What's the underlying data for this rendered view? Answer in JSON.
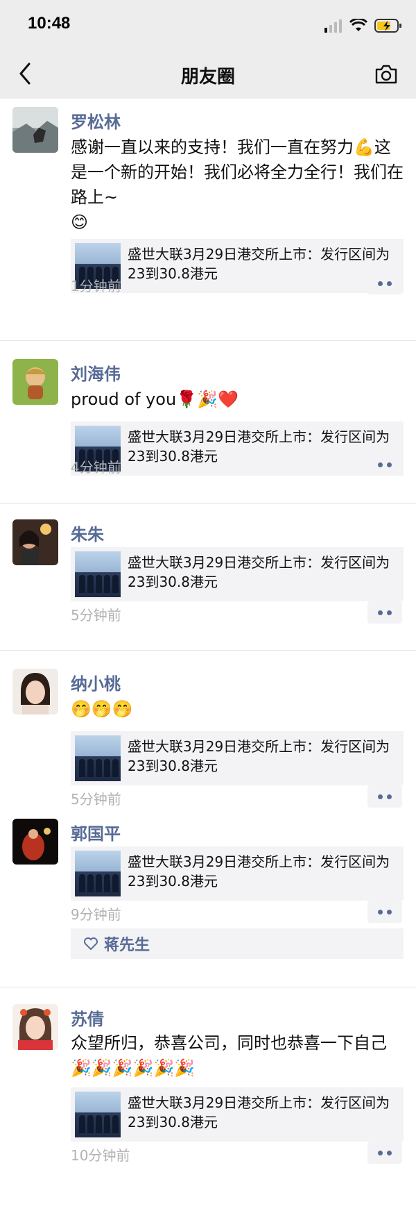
{
  "status": {
    "time": "10:48"
  },
  "nav": {
    "title": "朋友圈",
    "back_icon": "chevron-left-icon",
    "camera_icon": "camera-icon"
  },
  "share_card": {
    "text": "盛世大联3月29日港交所上市：发行区间为23到30.8港元"
  },
  "posts": [
    {
      "name": "罗松林",
      "text": "感谢一直以来的支持！我们一直在努力💪这是一个新的开始！我们必将全力全行！我们在路上~\n😊",
      "time": "1分钟前"
    },
    {
      "name": "刘海伟",
      "text": "proud of you🌹🎉❤️",
      "time": "4分钟前"
    },
    {
      "name": "朱朱",
      "text": "",
      "time": "5分钟前"
    },
    {
      "name": "纳小桃",
      "text": "🤭🤭🤭",
      "time": "5分钟前"
    },
    {
      "name": "郭国平",
      "text": "",
      "time": "9分钟前",
      "likes": "蒋先生"
    },
    {
      "name": "苏倩",
      "text": "众望所归，恭喜公司，同时也恭喜一下自己🎉🎉🎉🎉🎉🎉",
      "time": "10分钟前"
    }
  ],
  "colors": {
    "name_blue": "#576b95",
    "time_gray": "#b2b2b2",
    "card_bg": "#f3f3f5",
    "topbar_bg": "#ededed"
  }
}
